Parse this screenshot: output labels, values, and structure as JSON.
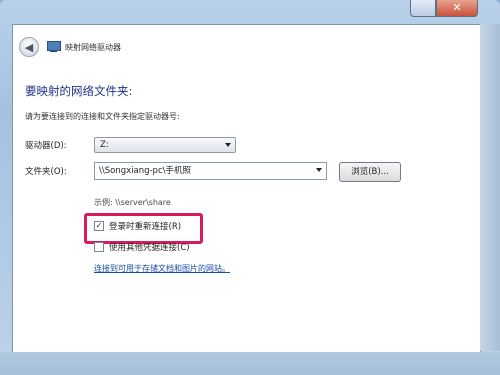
{
  "window": {
    "title": "映射网络驱动器",
    "close_glyph": "✕",
    "back_glyph": "◀"
  },
  "heading": "要映射的网络文件夹:",
  "instruction": "请为要连接到的连接和文件夹指定驱动器号:",
  "drive": {
    "label": "驱动器(D):",
    "value": "Z:"
  },
  "folder": {
    "label": "文件夹(O):",
    "value": "\\\\Songxiang-pc\\手机照",
    "browse_label": "浏览(B)..."
  },
  "example": "示例: \\\\server\\share",
  "reconnect": {
    "label": "登录时重新连接(R)",
    "checked": true,
    "check_glyph": "✓"
  },
  "other_credentials": {
    "label": "使用其他凭据连接(C)",
    "checked": false
  },
  "link_text": "连接到可用于存储文档和图片的网站。",
  "colors": {
    "heading": "#1e3287",
    "highlight": "#d81b5f",
    "link": "#1b4ba8"
  }
}
